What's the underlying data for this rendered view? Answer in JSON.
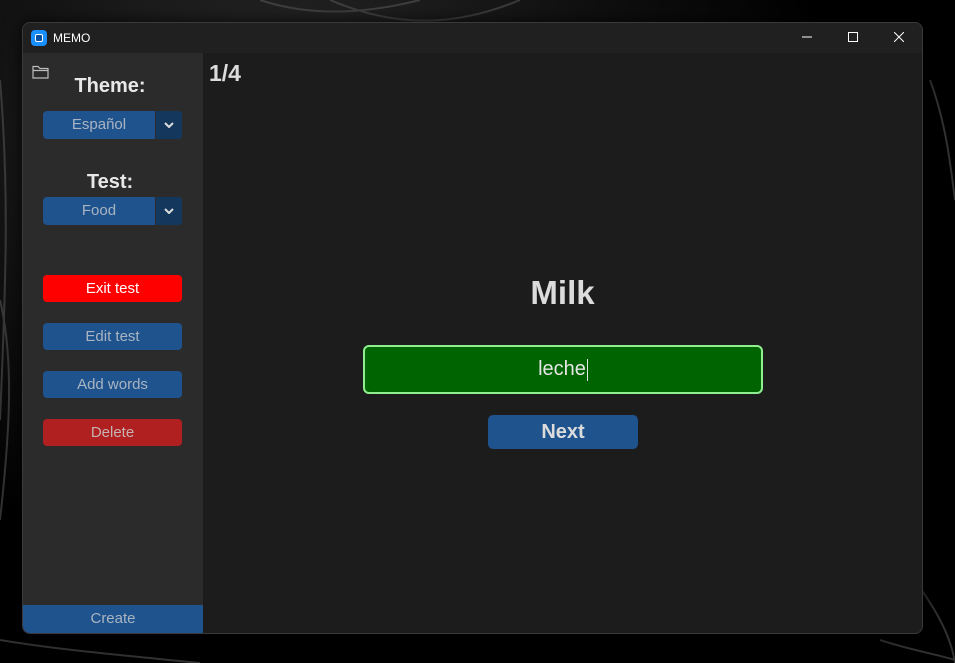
{
  "window": {
    "title": "MEMO"
  },
  "sidebar": {
    "theme_heading": "Theme:",
    "theme_selected": "Español",
    "test_heading": "Test:",
    "test_selected": "Food",
    "buttons": {
      "exit": "Exit test",
      "edit": "Edit test",
      "add": "Add words",
      "delete": "Delete"
    },
    "create": "Create"
  },
  "main": {
    "counter": "1/4",
    "word": "Milk",
    "answer_value": "leche",
    "next": "Next"
  },
  "colors": {
    "accent": "#1f538d",
    "exit": "#ff0000",
    "delete": "#b02020",
    "correct_bg": "#006400",
    "correct_border": "#90ee90"
  }
}
